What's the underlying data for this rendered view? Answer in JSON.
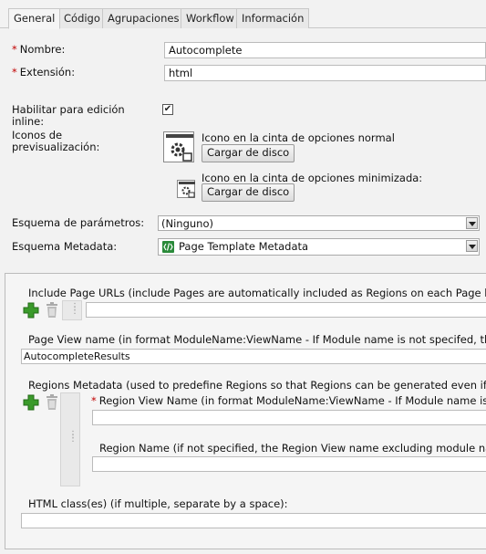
{
  "tabs": [
    {
      "label": "General",
      "active": true
    },
    {
      "label": "Código",
      "active": false
    },
    {
      "label": "Agrupaciones",
      "active": false
    },
    {
      "label": "Workflow",
      "active": false
    },
    {
      "label": "Información",
      "active": false
    }
  ],
  "form": {
    "nombre_label": "Nombre:",
    "nombre_value": "Autocomplete",
    "extension_label": "Extensión:",
    "extension_value": "html",
    "inline_label": "Habilitar para edición inline:",
    "inline_checked": true,
    "icons_label": "Iconos de previsualización:",
    "icon_normal_label": "Icono en la cinta de opciones normal",
    "icon_min_label": "Icono en la cinta de opciones minimizada:",
    "upload_label": "Cargar de disco",
    "param_schema_label": "Esquema de parámetros:",
    "param_schema_value": "(Ninguno)",
    "metadata_schema_label": "Esquema Metadata:",
    "metadata_schema_value": "Page Template Metadata"
  },
  "metadata": {
    "include_urls_label": "Include Page URLs (include Pages are automatically included as Regions on each Page base",
    "page_view_label": "Page View name (in format ModuleName:ViewName - If Module name is not specifed, the",
    "page_view_value": "AutocompleteResults",
    "regions_label": "Regions Metadata (used to predefine Regions so that Regions can be generated even if the",
    "region_view_label": "Region View Name (in format ModuleName:ViewName - If Module name is n",
    "region_name_label": "Region Name (if not specified, the Region View name excluding module nam",
    "html_class_label": "HTML class(es) (if multiple, separate by a space):"
  },
  "icons": {
    "add": "plus-icon",
    "delete": "trash-icon",
    "drag": "grip-icon",
    "ribbon": "gear-icon",
    "schema": "schema-icon"
  },
  "colors": {
    "required": "#c00000",
    "add_green": "#3a9a2a",
    "schema_green": "#2a8a3a"
  }
}
